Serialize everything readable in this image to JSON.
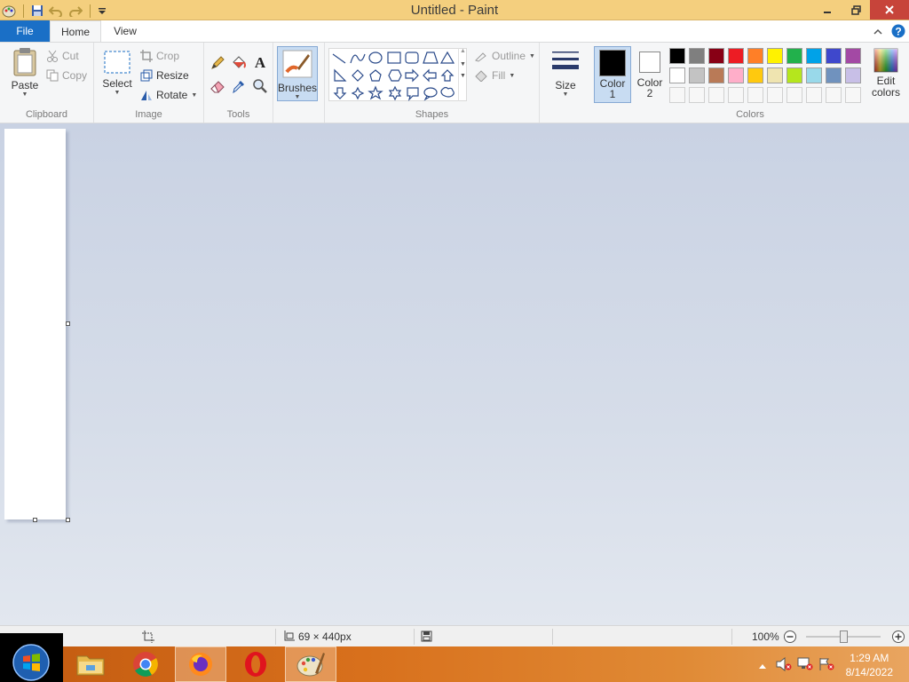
{
  "window": {
    "title": "Untitled - Paint"
  },
  "tabs": {
    "file": "File",
    "home": "Home",
    "view": "View"
  },
  "clipboard": {
    "paste": "Paste",
    "cut": "Cut",
    "copy": "Copy",
    "label": "Clipboard"
  },
  "image": {
    "select": "Select",
    "crop": "Crop",
    "resize": "Resize",
    "rotate": "Rotate",
    "label": "Image"
  },
  "tools": {
    "label": "Tools"
  },
  "brushes": {
    "label": "Brushes"
  },
  "shapes": {
    "outline": "Outline",
    "fill": "Fill",
    "label": "Shapes"
  },
  "size": {
    "label": "Size"
  },
  "colors": {
    "color1": "Color",
    "color1_num": "1",
    "color2": "Color",
    "color2_num": "2",
    "edit": "Edit",
    "edit2": "colors",
    "label": "Colors",
    "color1_value": "#000000",
    "color2_value": "#ffffff",
    "palette_row1": [
      "#000000",
      "#7f7f7f",
      "#880015",
      "#ed1c24",
      "#ff7f27",
      "#fff200",
      "#22b14c",
      "#00a2e8",
      "#3f48cc",
      "#a349a4"
    ],
    "palette_row2": [
      "#ffffff",
      "#c3c3c3",
      "#b97a57",
      "#ffaec9",
      "#ffc90e",
      "#efe4b0",
      "#b5e61d",
      "#99d9ea",
      "#7092be",
      "#c8bfe7"
    ]
  },
  "status": {
    "dimensions": "69 × 440px",
    "zoom": "100%"
  },
  "taskbar": {
    "time": "1:29 AM",
    "date": "8/14/2022"
  }
}
